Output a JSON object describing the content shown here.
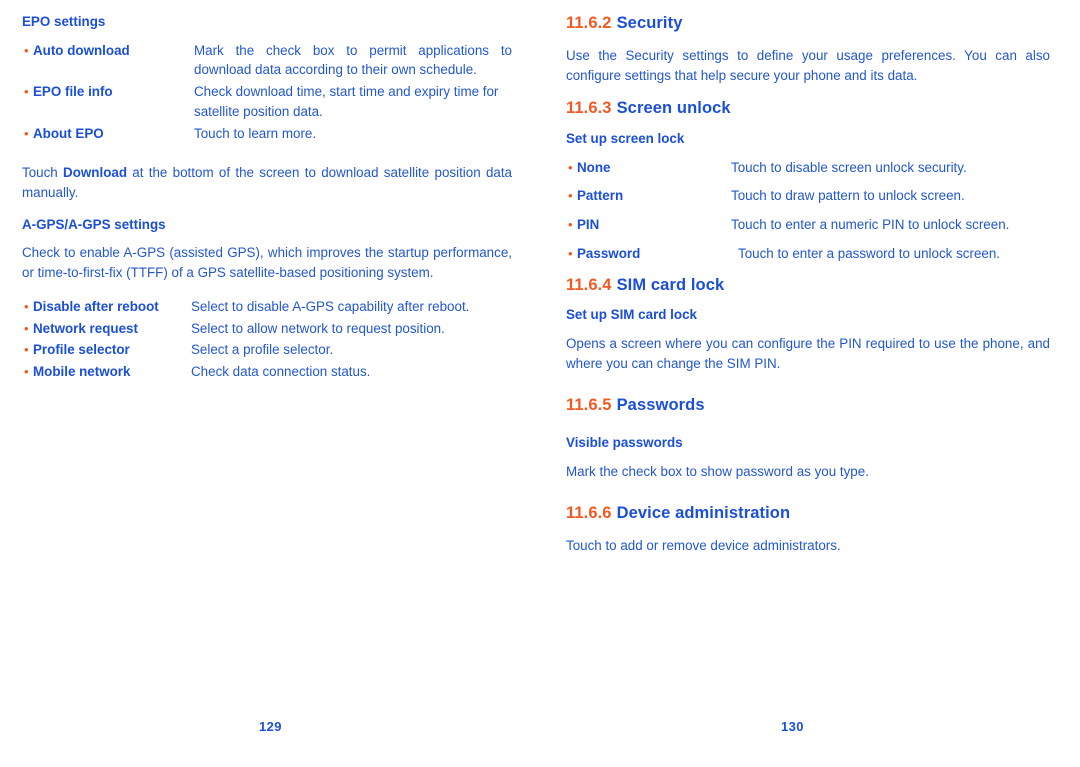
{
  "colors": {
    "heading_blue": "#1b4fd8",
    "body_blue": "#2357cf",
    "accent_orange": "#f15a22"
  },
  "left_page": {
    "folio": "129",
    "epo": {
      "heading_bold": "EPO",
      "heading_rest": " settings",
      "items": [
        {
          "term": "Auto download",
          "desc": "Mark the check box to permit applications to download data according to their own schedule."
        },
        {
          "term": "EPO file info",
          "desc": "Check download time, start time and expiry time for satellite position data."
        },
        {
          "term": "About EPO",
          "desc": "Touch to learn more."
        }
      ],
      "paragraph_pre": "Touch ",
      "paragraph_bold": "Download",
      "paragraph_post": " at the bottom of the screen to download satellite position data manually."
    },
    "agps": {
      "heading_bold": "A-GPS/A-GPS",
      "heading_rest": " settings",
      "paragraph": "Check to enable A-GPS (assisted GPS), which improves the startup performance, or time-to-first-fix (TTFF) of a GPS satellite-based positioning system.",
      "items": [
        {
          "term": "Disable after reboot",
          "desc": "Select to disable A-GPS capability after reboot."
        },
        {
          "term": "Network request",
          "desc": "Select to allow network to request position."
        },
        {
          "term": "Profile selector",
          "desc": "Select a profile selector."
        },
        {
          "term": "Mobile network",
          "desc": "Check data connection status."
        }
      ]
    }
  },
  "right_page": {
    "folio": "130",
    "security": {
      "number": "11.6.2",
      "title": "Security",
      "paragraph": "Use the Security settings to define your usage preferences. You can also configure settings that help secure your phone and its data."
    },
    "screen_unlock": {
      "number": "11.6.3",
      "title": "Screen unlock",
      "subheading": "Set up screen lock",
      "items": [
        {
          "term": "None",
          "desc": "Touch to disable screen unlock security."
        },
        {
          "term": "Pattern",
          "desc": "Touch to draw pattern to unlock screen."
        },
        {
          "term": "PIN",
          "desc": "Touch to enter a numeric PIN to unlock screen."
        },
        {
          "term": "Password",
          "desc": "Touch to enter a password to unlock screen."
        }
      ]
    },
    "sim_card_lock": {
      "number": "11.6.4",
      "title": "SIM card lock",
      "subheading_pre": "Set up ",
      "subheading_bold": "SIM",
      "subheading_post": " card lock",
      "paragraph": "Opens a screen where you can configure the PIN required to use the phone, and where you can change the SIM PIN."
    },
    "passwords": {
      "number": "11.6.5",
      "title": "Passwords",
      "subheading": "Visible passwords",
      "paragraph": "Mark the check box to show password as you type."
    },
    "device_administration": {
      "number": "11.6.6",
      "title": "Device administration",
      "paragraph": "Touch to add or remove device administrators."
    }
  }
}
